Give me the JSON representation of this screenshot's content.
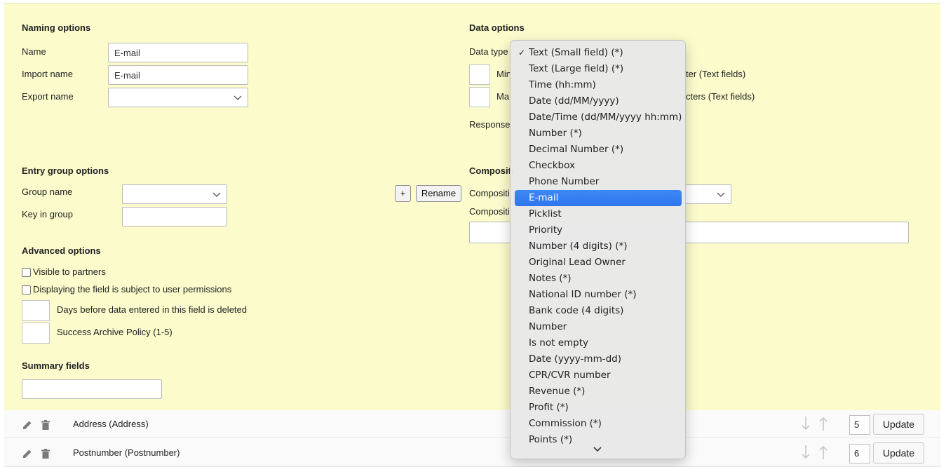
{
  "naming": {
    "heading": "Naming options",
    "name_label": "Name",
    "name_value": "E-mail",
    "import_label": "Import name",
    "import_value": "E-mail",
    "export_label": "Export name",
    "export_value": ""
  },
  "entry_group": {
    "heading": "Entry group options",
    "group_label": "Group name",
    "group_value": "",
    "key_label": "Key in group",
    "key_value": "",
    "plus_label": "+",
    "rename_label": "Rename"
  },
  "advanced": {
    "heading": "Advanced options",
    "visible_partners": "Visible to partners",
    "permissions": "Displaying the field is subject to user permissions",
    "days_label": "Days before data entered in this field is deleted",
    "success_label": "Success Archive Policy (1-5)"
  },
  "summary": {
    "heading": "Summary fields",
    "value": ""
  },
  "data_options": {
    "heading": "Data options",
    "type_label": "Data type",
    "min_partial": "Min",
    "min_suffix": "ter (Text fields)",
    "max_partial": "Ma",
    "max_suffix": "cters (Text fields)",
    "response_partial": "Response"
  },
  "composite": {
    "heading_partial": "Compositi",
    "label1_partial": "Compositi",
    "label2_partial": "Compositi"
  },
  "dropdown": {
    "check": "✓",
    "selected_index": 9,
    "options": [
      "Text (Small field) (*)",
      "Text (Large field) (*)",
      "Time (hh:mm)",
      "Date (dd/MM/yyyy)",
      "Date/Time (dd/MM/yyyy hh:mm)",
      "Number (*)",
      "Decimal Number (*)",
      "Checkbox",
      "Phone Number",
      "E-mail",
      "Picklist",
      "Priority",
      "Number (4 digits) (*)",
      "Original Lead Owner",
      "Notes (*)",
      "National ID number (*)",
      "Bank code (4 digits)",
      "Number",
      "Is not empty",
      "Date (yyyy-mm-dd)",
      "CPR/CVR number",
      "Revenue (*)",
      "Profit (*)",
      "Commission (*)",
      "Points (*)"
    ]
  },
  "rows": [
    {
      "label": "Address (Address)",
      "position": "5",
      "update": "Update"
    },
    {
      "label": "Postnumber (Postnumber)",
      "position": "6",
      "update": "Update"
    }
  ]
}
